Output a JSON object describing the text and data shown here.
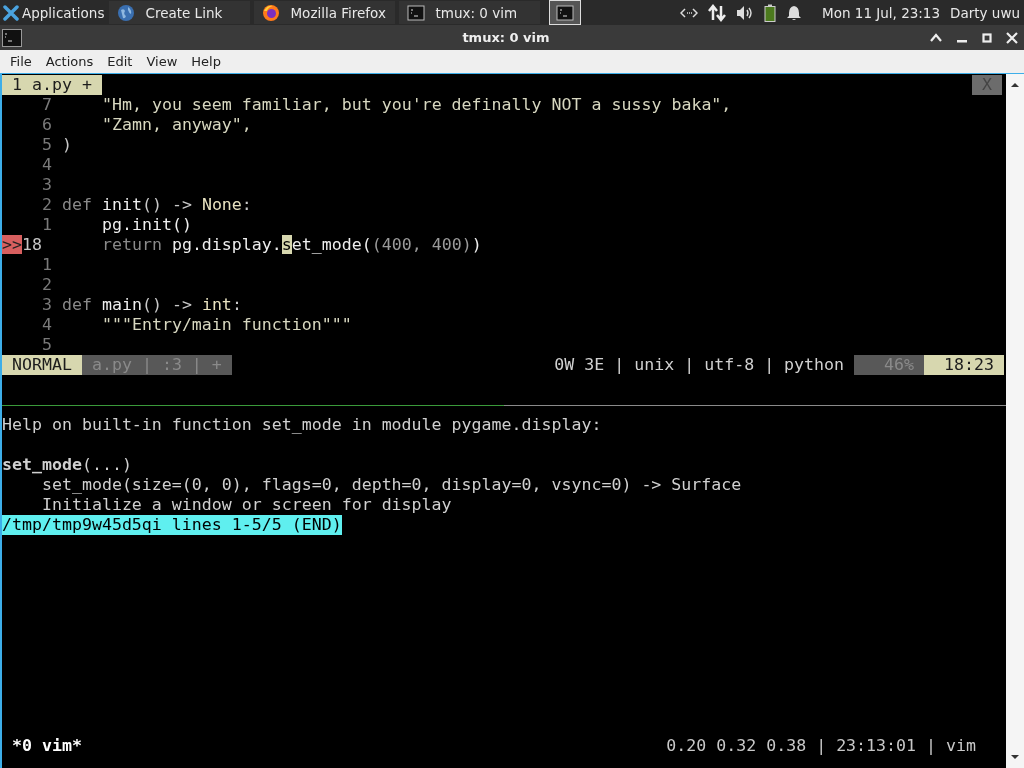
{
  "taskbar": {
    "apps_label": "Applications",
    "tasks": [
      {
        "label": "Create Link",
        "kind": "globe",
        "selected": false
      },
      {
        "label": "Mozilla Firefox",
        "kind": "firefox",
        "selected": false
      },
      {
        "label": "tmux: 0 vim",
        "kind": "terminal",
        "selected": false
      },
      {
        "kind": "terminal",
        "selected": true
      }
    ],
    "clock": "Mon 11 Jul, 23:13",
    "user": "Darty uwu"
  },
  "window": {
    "title": "tmux: 0 vim"
  },
  "menu": [
    "File",
    "Actions",
    "Edit",
    "View",
    "Help"
  ],
  "editor": {
    "tab": "1 a.py +",
    "close": "X",
    "lines": [
      {
        "number": "7",
        "tokens": [
          {
            "text": "    \"Hm, you seem familiar, but you're definally NOT a sussy baka\",",
            "kind": "string"
          }
        ]
      },
      {
        "number": "6",
        "tokens": [
          {
            "text": "    \"Zamn, anyway\",",
            "kind": "string"
          }
        ]
      },
      {
        "number": "5",
        "tokens": [
          {
            "text": ")",
            "kind": "plain"
          }
        ]
      },
      {
        "number": "4"
      },
      {
        "number": "3"
      },
      {
        "number": "2",
        "tokens": [
          {
            "text": "def ",
            "kind": "keyword"
          },
          {
            "text": "init",
            "kind": "name"
          },
          {
            "text": "() -> ",
            "kind": "plain"
          },
          {
            "text": "None",
            "kind": "const"
          },
          {
            "text": ":",
            "kind": "plain"
          }
        ]
      },
      {
        "number": "1",
        "tokens": [
          {
            "text": "    pg.init()",
            "kind": "name"
          }
        ]
      },
      {
        "number": "18",
        "sign": ">>",
        "tokens": [
          {
            "text": "    return",
            "kind": "keyword"
          },
          {
            "text": " pg.display.",
            "kind": "name"
          },
          {
            "text": "s",
            "kind": "cursor"
          },
          {
            "text": "et_mode(",
            "kind": "name"
          },
          {
            "text": "(400, 400)",
            "kind": "dim"
          },
          {
            "text": ")",
            "kind": "name"
          }
        ]
      },
      {
        "number": "1"
      },
      {
        "number": "2"
      },
      {
        "number": "3",
        "tokens": [
          {
            "text": "def ",
            "kind": "keyword"
          },
          {
            "text": "main",
            "kind": "name"
          },
          {
            "text": "() -> ",
            "kind": "plain"
          },
          {
            "text": "int",
            "kind": "const"
          },
          {
            "text": ":",
            "kind": "plain"
          }
        ]
      },
      {
        "number": "4",
        "tokens": [
          {
            "text": "    \"\"\"Entry/main function\"\"\"",
            "kind": "string"
          }
        ]
      },
      {
        "number": "5"
      }
    ],
    "status": {
      "mode": "NORMAL",
      "file": "a.py | :3 | +",
      "info": "0W 3E | unix | utf-8 | python",
      "percent": "46%",
      "position": "18:23"
    }
  },
  "help": {
    "lines": [
      {
        "kind": "text",
        "text": "Help on built-in function set_mode in module pygame.display:"
      },
      {
        "kind": "blank"
      },
      {
        "kind": "text",
        "text": "**set_mode**(...)"
      },
      {
        "kind": "text",
        "text": "    set_mode(size=(0, 0), flags=0, depth=0, display=0, vsync=0) -> Surface"
      },
      {
        "kind": "text",
        "text": "    Initialize a window or screen for display"
      }
    ],
    "pager_status": "/tmp/tmp9w45d5qi lines 1-5/5 (END)"
  },
  "tmux": {
    "left": "*0 vim*",
    "right": "0.20 0.32 0.38 | 23:13:01 | vim"
  }
}
